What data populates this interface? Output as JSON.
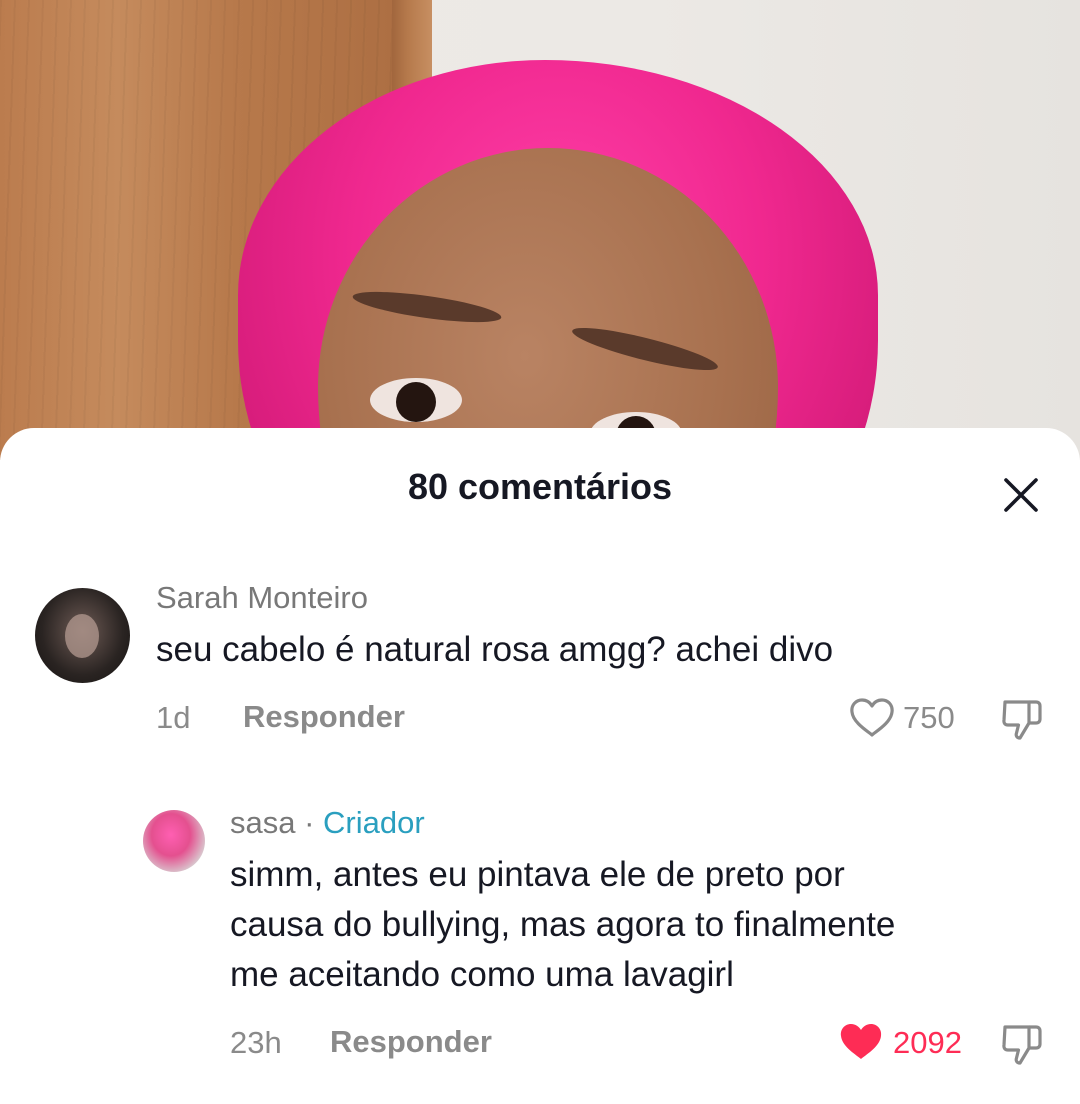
{
  "sheet": {
    "title": "80 comentários"
  },
  "comments": [
    {
      "username": "Sarah Monteiro",
      "text": "seu cabelo é natural rosa amgg? achei divo",
      "time": "1d",
      "reply_label": "Responder",
      "likes": "750",
      "liked": false
    },
    {
      "username": "sasa",
      "separator": " · ",
      "badge": "Criador",
      "text_lines": [
        "simm, antes eu pintava ele de preto por",
        "causa do bullying, mas agora to finalmente",
        "me aceitando como uma lavagirl"
      ],
      "time": "23h",
      "reply_label": "Responder",
      "likes": "2092",
      "liked": true
    }
  ],
  "colors": {
    "liked": "#fe2c55",
    "muted": "#8a8a8a",
    "creator_badge": "#2a9fbf",
    "text": "#161823"
  }
}
